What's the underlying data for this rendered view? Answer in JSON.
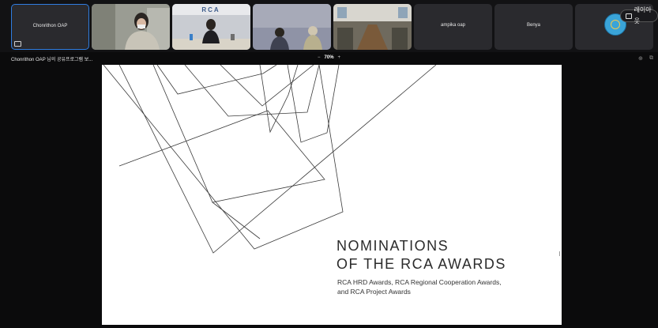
{
  "participants": [
    {
      "name": "Chonrithon OAP",
      "active": true,
      "video": false
    },
    {
      "name": "",
      "active": false,
      "video": true
    },
    {
      "name": "",
      "active": false,
      "video": true,
      "banner": "RCA"
    },
    {
      "name": "",
      "active": false,
      "video": true
    },
    {
      "name": "",
      "active": false,
      "video": true
    },
    {
      "name": "ampika oap",
      "active": false,
      "video": false
    },
    {
      "name": "Benya",
      "active": false,
      "video": false
    }
  ],
  "layout_button": {
    "label": "레이아웃",
    "icon": "layout-icon"
  },
  "share": {
    "title": "Chonrithon OAP 님의 공유프로그램 보..."
  },
  "zoom": {
    "minus": "−",
    "level": "70%",
    "plus": "+"
  },
  "slide": {
    "title_line1": "NOMINATIONS",
    "title_line2": "OF THE RCA AWARDS",
    "subtitle_line1": "RCA HRD Awards, RCA Regional Cooperation Awards,",
    "subtitle_line2": "and RCA Project Awards"
  },
  "colors": {
    "active_border": "#2f7de1",
    "tile_bg": "#2a2a2e",
    "background": "#0b0b0c"
  }
}
